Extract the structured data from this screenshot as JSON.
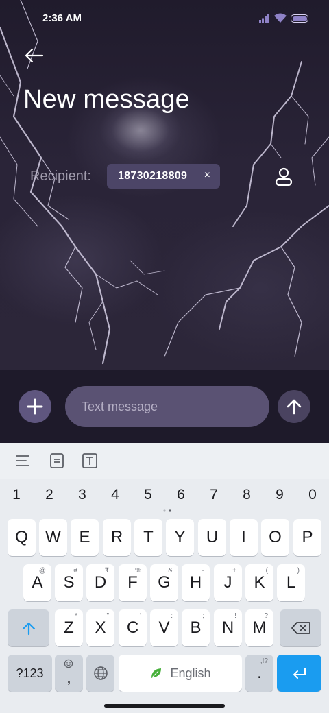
{
  "status_bar": {
    "time": "2:36 AM"
  },
  "header": {
    "title": "New message"
  },
  "recipient": {
    "label": "Recipient:",
    "chip_number": "18730218809",
    "chip_remove": "×"
  },
  "compose": {
    "placeholder": "Text message"
  },
  "keyboard": {
    "numbers": [
      "1",
      "2",
      "3",
      "4",
      "5",
      "6",
      "7",
      "8",
      "9",
      "0"
    ],
    "row1": [
      "Q",
      "W",
      "E",
      "R",
      "T",
      "Y",
      "U",
      "I",
      "O",
      "P"
    ],
    "row2": [
      {
        "key": "A",
        "sup": "@"
      },
      {
        "key": "S",
        "sup": "#"
      },
      {
        "key": "D",
        "sup": "₹"
      },
      {
        "key": "F",
        "sup": "%"
      },
      {
        "key": "G",
        "sup": "&"
      },
      {
        "key": "H",
        "sup": "-"
      },
      {
        "key": "J",
        "sup": "+"
      },
      {
        "key": "K",
        "sup": "("
      },
      {
        "key": "L",
        "sup": ")"
      }
    ],
    "row3": [
      {
        "key": "Z",
        "sup": "*"
      },
      {
        "key": "X",
        "sup": "\""
      },
      {
        "key": "C",
        "sup": "'"
      },
      {
        "key": "V",
        "sup": ":"
      },
      {
        "key": "B",
        "sup": ";"
      },
      {
        "key": "N",
        "sup": "!"
      },
      {
        "key": "M",
        "sup": "?"
      }
    ],
    "symbols_label": "?123",
    "comma_label": ",",
    "space_label": "English",
    "period_label": ".",
    "period_sup": ",!?"
  },
  "icons": {
    "back": "back-arrow-icon",
    "contact": "person-icon",
    "add": "plus-icon",
    "send": "send-arrow-icon",
    "shift": "shift-arrow-icon",
    "backspace": "backspace-icon",
    "globe": "globe-icon",
    "emoji": "emoji-icon",
    "enter": "enter-icon"
  },
  "colors": {
    "accent_blue": "#1a9cf0",
    "chip_bg": "#4c4567",
    "compose_bg": "#1e1a2a",
    "text_field_bg": "#5a5273"
  }
}
